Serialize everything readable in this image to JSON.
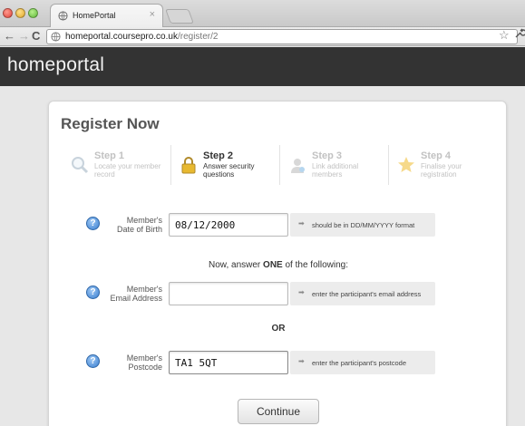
{
  "browser": {
    "tab_title": "HomePortal",
    "tab_close": "×",
    "url_host": "homeportal.coursepro.co.uk",
    "url_path": "/register/2",
    "back": "←",
    "forward": "→",
    "reload": "C",
    "bookmark": "☆",
    "wrench": "🔧"
  },
  "site": {
    "brand": "homeportal"
  },
  "card": {
    "title": "Register Now"
  },
  "steps": [
    {
      "name": "Step 1",
      "desc": "Locate your member record",
      "state": "inactive",
      "icon": "magnifier-icon"
    },
    {
      "name": "Step 2",
      "desc": "Answer security questions",
      "state": "active",
      "icon": "padlock-icon"
    },
    {
      "name": "Step 3",
      "desc": "Link additional members",
      "state": "inactive",
      "icon": "user-icon"
    },
    {
      "name": "Step 4",
      "desc": "Finalise your registration",
      "state": "inactive",
      "icon": "star-icon"
    }
  ],
  "fields": {
    "dob": {
      "label_line1": "Member's",
      "label_line2": "Date of Birth",
      "value": "08/12/2000",
      "hint": "should be in DD/MM/YYYY format"
    },
    "email": {
      "label_line1": "Member's",
      "label_line2": "Email Address",
      "value": "",
      "hint": "enter the participant's email address"
    },
    "postcode": {
      "label_line1": "Member's",
      "label_line2": "Postcode",
      "value": "TA1 5QT",
      "hint": "enter the participant's postcode"
    }
  },
  "instructions": {
    "before": "Now, answer ",
    "emph": "ONE",
    "after": " of the following:"
  },
  "or_text": "OR",
  "help_glyph": "?",
  "hint_arrow": "➡",
  "continue_label": "Continue",
  "colors": {
    "header_bg": "#333333",
    "help_blue": "#3a7fd1",
    "hint_bg": "#ececec"
  }
}
